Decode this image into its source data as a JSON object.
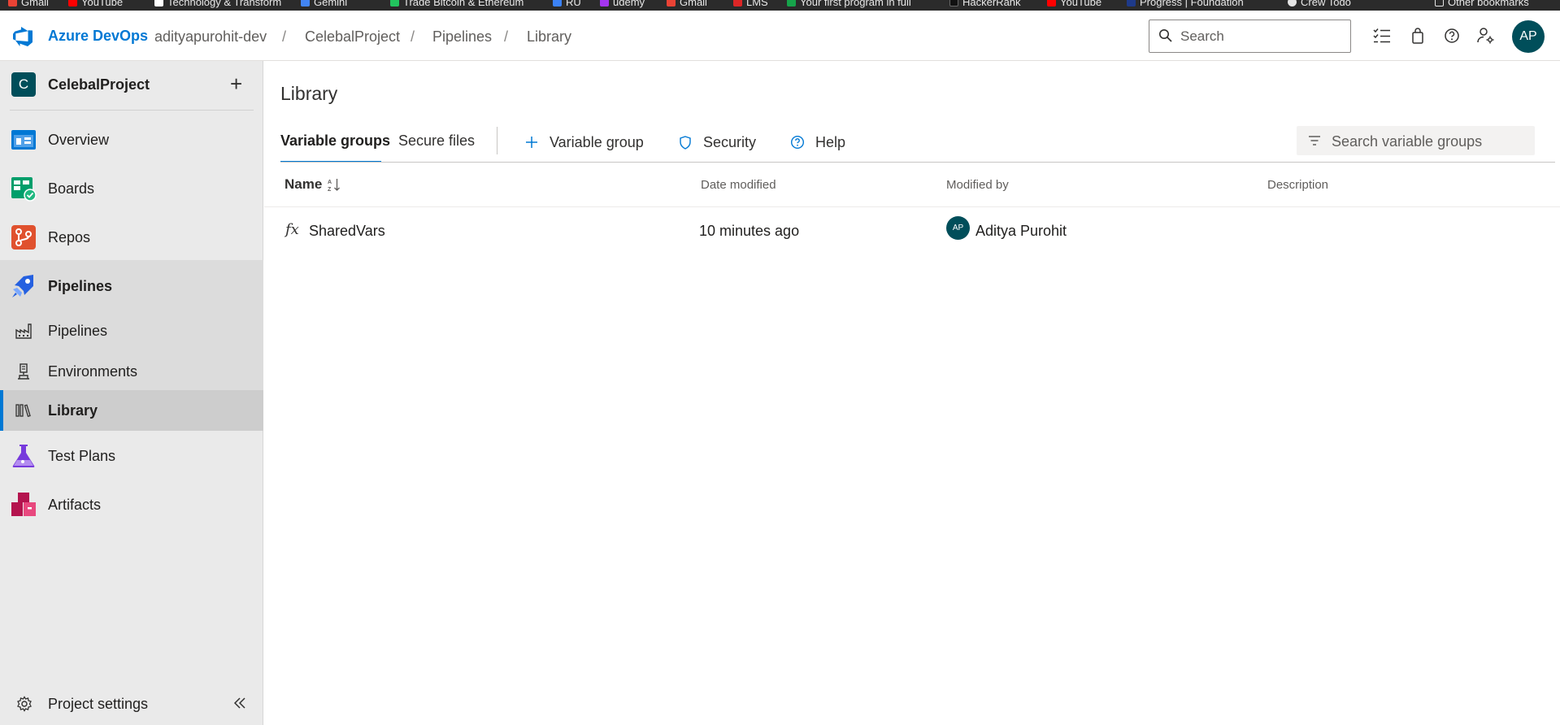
{
  "bookmarks": [
    {
      "label": "Gmail",
      "color": "#ea4335"
    },
    {
      "label": "YouTube",
      "color": "#ff0000"
    },
    {
      "label": "Technology & Transform",
      "color": "#ffffff"
    },
    {
      "label": "Gemini",
      "color": "#4285f4"
    },
    {
      "label": "Trade Bitcoin & Ethereum",
      "color": "#22c55e"
    },
    {
      "label": "RU",
      "color": "#3b82f6"
    },
    {
      "label": "udemy",
      "color": "#a435f0"
    },
    {
      "label": "Gmail",
      "color": "#ea4335"
    },
    {
      "label": "LMS",
      "color": "#dc2626"
    },
    {
      "label": "Your first program in full",
      "color": "#16a34a"
    },
    {
      "label": "HackerRank",
      "color": "#111111"
    },
    {
      "label": "YouTube",
      "color": "#ff0000"
    },
    {
      "label": "Progress | Foundation",
      "color": "#1e3a8a"
    },
    {
      "label": "Crew Todo",
      "color": "#e5e5e5"
    },
    {
      "label": "Other bookmarks",
      "color": "#e5e5e5"
    }
  ],
  "header": {
    "brand": "Azure DevOps",
    "breadcrumb": [
      "adityapurohit-dev",
      "CelebalProject",
      "Pipelines",
      "Library"
    ],
    "search_placeholder": "Search",
    "user_initials": "AP",
    "icons": [
      "task-list-icon",
      "shopping-bag-icon",
      "help-icon",
      "user-settings-icon"
    ]
  },
  "sidebar": {
    "project_initial": "C",
    "project_name": "CelebalProject",
    "add_label": "+",
    "items": [
      {
        "label": "Overview",
        "icon": "overview-icon"
      },
      {
        "label": "Boards",
        "icon": "boards-icon"
      },
      {
        "label": "Repos",
        "icon": "repos-icon"
      },
      {
        "label": "Pipelines",
        "icon": "pipelines-icon"
      }
    ],
    "subitems": [
      {
        "label": "Pipelines",
        "icon": "pipeline-factory-icon"
      },
      {
        "label": "Environments",
        "icon": "environments-icon"
      },
      {
        "label": "Library",
        "icon": "library-icon"
      }
    ],
    "items_after": [
      {
        "label": "Test Plans",
        "icon": "test-plans-icon"
      },
      {
        "label": "Artifacts",
        "icon": "artifacts-icon"
      }
    ],
    "settings_label": "Project settings"
  },
  "main": {
    "title": "Library",
    "tabs": [
      "Variable groups",
      "Secure files"
    ],
    "commands": {
      "add": "Variable group",
      "security": "Security",
      "help": "Help"
    },
    "filter_placeholder": "Search variable groups",
    "table": {
      "columns": [
        "Name",
        "Date modified",
        "Modified by",
        "Description"
      ],
      "rows": [
        {
          "name": "SharedVars",
          "date": "10 minutes ago",
          "modified_by": "Aditya Purohit",
          "initials": "AP",
          "description": ""
        }
      ]
    }
  },
  "colors": {
    "accent": "#0078d4",
    "avatar": "#004e5a",
    "sidebar_bg": "#eaeaea"
  }
}
